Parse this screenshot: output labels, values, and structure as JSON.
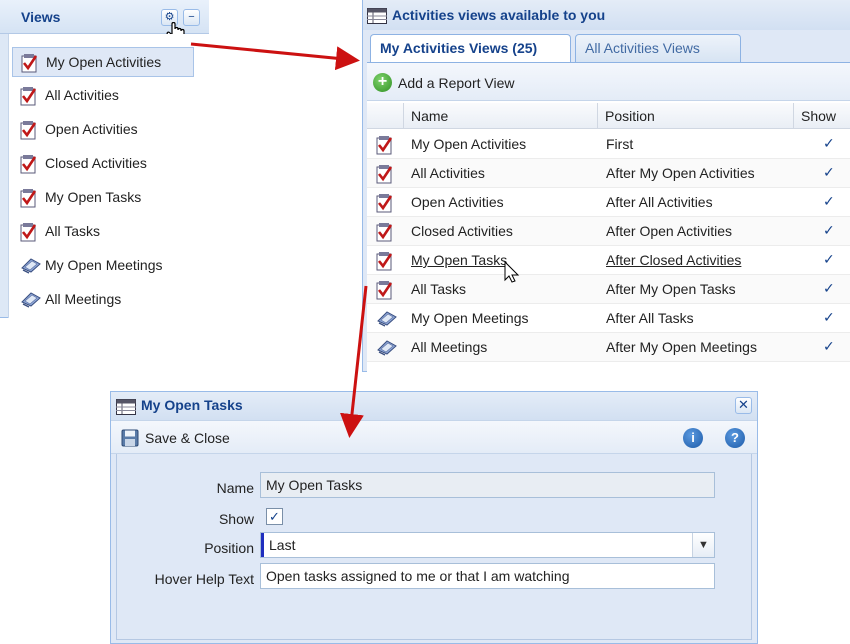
{
  "views_panel": {
    "title": "Views",
    "items": [
      {
        "label": "My Open Activities",
        "icon": "checked-note-icon",
        "selected": true
      },
      {
        "label": "All Activities",
        "icon": "checked-note-icon"
      },
      {
        "label": "Open Activities",
        "icon": "checked-note-icon"
      },
      {
        "label": "Closed Activities",
        "icon": "checked-note-icon"
      },
      {
        "label": "My Open Tasks",
        "icon": "checked-note-icon"
      },
      {
        "label": "All Tasks",
        "icon": "checked-note-icon"
      },
      {
        "label": "My Open Meetings",
        "icon": "meeting-icon"
      },
      {
        "label": "All Meetings",
        "icon": "meeting-icon"
      }
    ]
  },
  "views_window": {
    "title": "Activities views available to you",
    "tabs": [
      {
        "label": "My Activities Views (25)",
        "active": true
      },
      {
        "label": "All Activities Views",
        "active": false
      }
    ],
    "add_button": "Add a Report View",
    "columns": [
      "Name",
      "Position",
      "Show"
    ],
    "rows": [
      {
        "name": "My Open Activities",
        "position": "First",
        "show": "✓",
        "icon": "checked-note-icon"
      },
      {
        "name": "All Activities",
        "position": "After My Open Activities",
        "show": "✓",
        "icon": "checked-note-icon"
      },
      {
        "name": "Open Activities",
        "position": "After All Activities",
        "show": "✓",
        "icon": "checked-note-icon"
      },
      {
        "name": "Closed Activities",
        "position": "After Open Activities",
        "show": "✓",
        "icon": "checked-note-icon"
      },
      {
        "name": "My Open Tasks",
        "position": "After Closed Activities",
        "show": "✓",
        "icon": "checked-note-icon",
        "hovered": true
      },
      {
        "name": "All Tasks",
        "position": "After My Open Tasks",
        "show": "✓",
        "icon": "checked-note-icon"
      },
      {
        "name": "My Open Meetings",
        "position": "After All Tasks",
        "show": "✓",
        "icon": "meeting-icon"
      },
      {
        "name": "All Meetings",
        "position": "After My Open Meetings",
        "show": "✓",
        "icon": "meeting-icon"
      }
    ]
  },
  "edit_dialog": {
    "title": "My Open Tasks",
    "save_label": "Save & Close",
    "info_glyph": "i",
    "help_glyph": "?",
    "close_glyph": "✕",
    "fields": {
      "name_label": "Name",
      "name_value": "My Open Tasks",
      "show_label": "Show",
      "show_checked": true,
      "show_glyph": "✓",
      "position_label": "Position",
      "position_value": "Last",
      "hover_label": "Hover Help Text",
      "hover_value": "Open tasks assigned to me or that I am watching"
    }
  },
  "tools": {
    "gear_glyph": "⚙",
    "collapse_glyph": "−",
    "plus_glyph": "+",
    "dropdown_glyph": "▼"
  },
  "colors": {
    "accent": "#15428b",
    "arrow": "#cc1111",
    "panel_bg": "#dfe8f6"
  }
}
